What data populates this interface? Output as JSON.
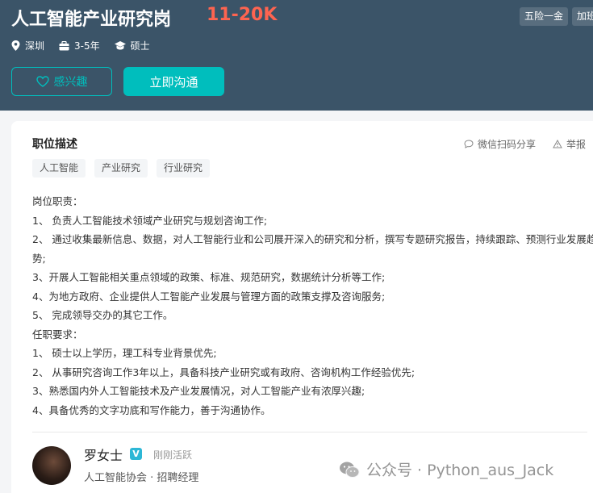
{
  "job": {
    "title": "人工智能产业研究岗",
    "salary": "11-20K",
    "city": "深圳",
    "experience": "3-5年",
    "degree": "硕士"
  },
  "benefits": [
    "五险一金",
    "加班"
  ],
  "actions": {
    "interest_label": "感兴趣",
    "chat_label": "立即沟通",
    "share_label": "微信扫码分享",
    "report_label": "举报"
  },
  "description": {
    "section_title": "职位描述",
    "tags": [
      "人工智能",
      "产业研究",
      "行业研究"
    ],
    "lines": [
      "岗位职责：",
      "1、 负责人工智能技术领域产业研究与规划咨询工作;",
      "2、 通过收集最新信息、数据，对人工智能行业和公司展开深入的研究和分析，撰写专题研究报告，持续跟踪、预测行业发展趋势;",
      "3、开展人工智能相关重点领域的政策、标准、规范研究，数据统计分析等工作;",
      " 4、为地方政府、企业提供人工智能产业发展与管理方面的政策支撑及咨询服务;",
      " 5、 完成领导交办的其它工作。",
      " 任职要求：",
      "1、 硕士以上学历，理工科专业背景优先;",
      "2、 从事研究咨询工作3年以上，具备科技产业研究或有政府、咨询机构工作经验优先;",
      "3、熟悉国内外人工智能技术及产业发展情况，对人工智能产业有浓厚兴趣;",
      "4、具备优秀的文字功底和写作能力，善于沟通协作。"
    ]
  },
  "recruiter": {
    "name": "罗女士",
    "verified_mark": "V",
    "status": "刚刚活跃",
    "company_line": "人工智能协会 · 招聘经理"
  },
  "watermark": {
    "text": "公众号 · Python_aus_Jack"
  },
  "colors": {
    "header_bg": "#3b5468",
    "salary": "#fe6450",
    "accent": "#00bebd"
  }
}
